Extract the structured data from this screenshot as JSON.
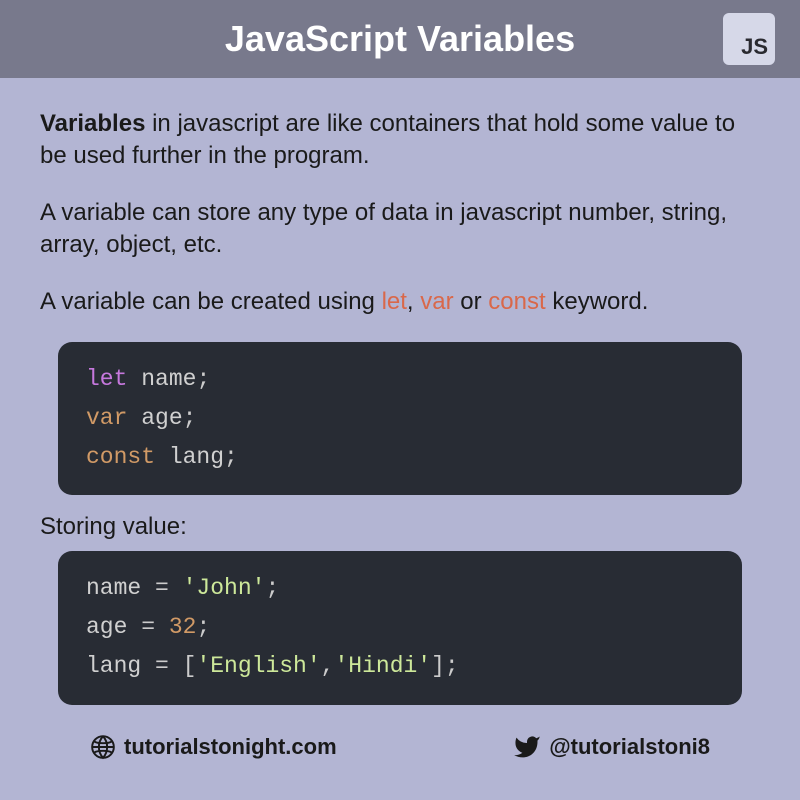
{
  "header": {
    "title": "JavaScript Variables",
    "badge": "JS"
  },
  "paragraphs": {
    "p1_bold": "Variables",
    "p1_rest": " in javascript are like containers that hold some value to be used further in the program.",
    "p2": "A variable can store any type of data in javascript number, string, array, object, etc.",
    "p3_pre": "A variable can be created using ",
    "p3_kw1": "let",
    "p3_sep1": ", ",
    "p3_kw2": "var",
    "p3_sep2": " or ",
    "p3_kw3": "const",
    "p3_post": " keyword."
  },
  "code1": {
    "line1": {
      "kw": "let",
      "ident": " name",
      "punc": ";"
    },
    "line2": {
      "kw": "var",
      "ident": " age",
      "punc": ";"
    },
    "line3": {
      "kw": "const",
      "ident": " lang",
      "punc": ";"
    }
  },
  "section_label": "Storing value:",
  "code2": {
    "line1": {
      "ident": "name ",
      "op": "= ",
      "str": "'John'",
      "punc": ";"
    },
    "line2": {
      "ident": "age ",
      "op": "= ",
      "num": "32",
      "punc": ";"
    },
    "line3": {
      "ident": "lang ",
      "op": "= [",
      "str1": "'English'",
      "sep": ",",
      "str2": "'Hindi'",
      "close": "];"
    }
  },
  "footer": {
    "website": "tutorialstonight.com",
    "twitter": "@tutorialstoni8"
  }
}
